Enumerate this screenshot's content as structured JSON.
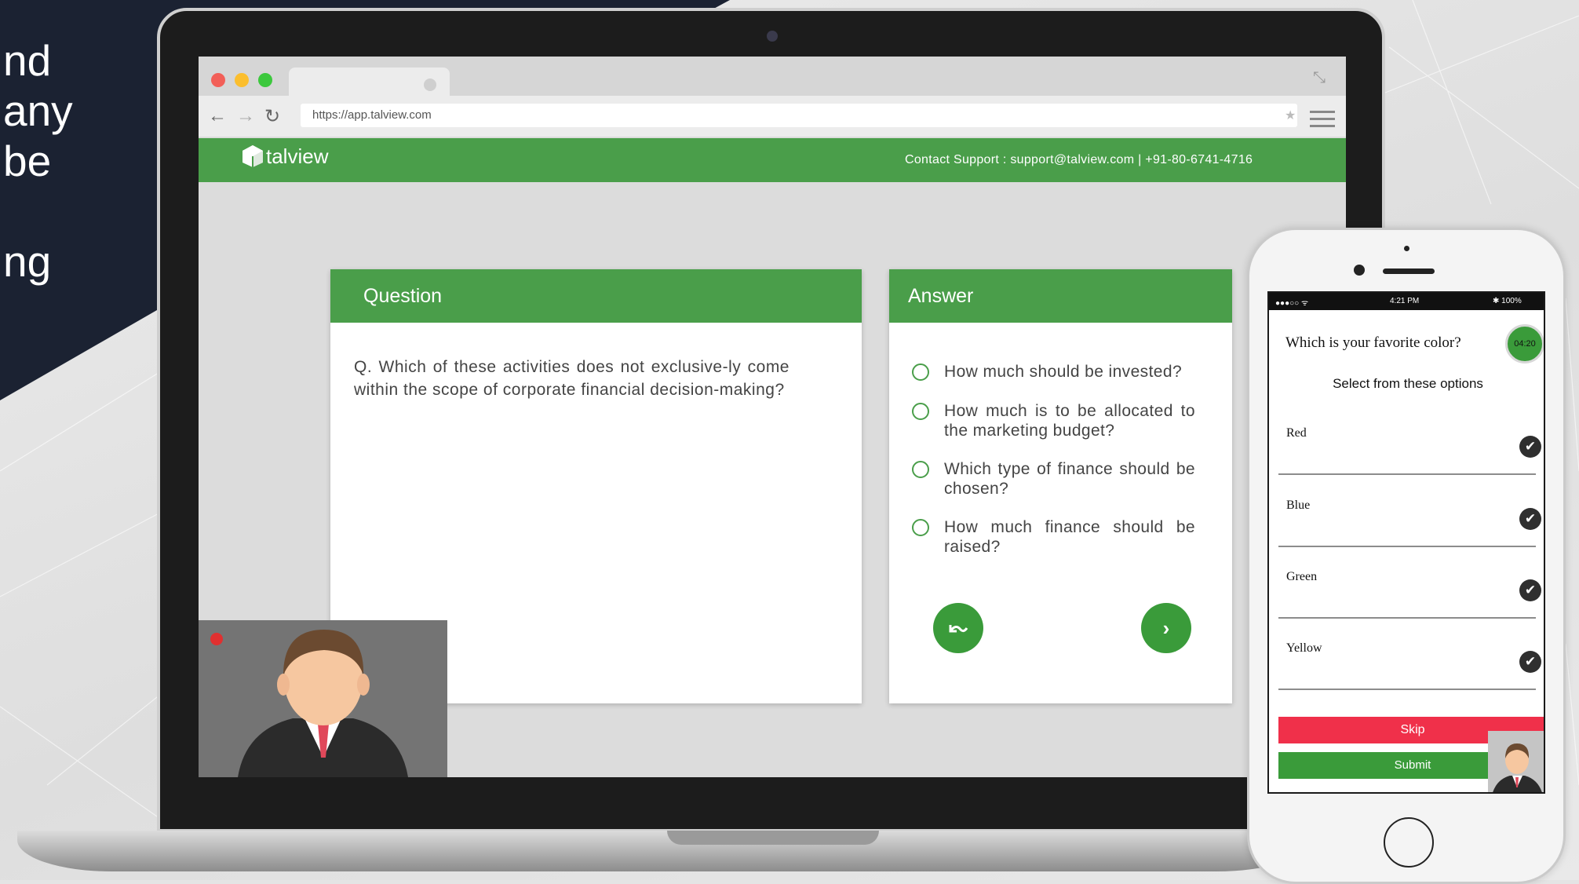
{
  "hero": {
    "lines": [
      "nd",
      "any",
      "be",
      "",
      "ng"
    ]
  },
  "browser": {
    "url": "https://app.talview.com",
    "traffic_lights": [
      "#f25f58",
      "#fbbe2e",
      "#3cc83d"
    ]
  },
  "app": {
    "brand": "talview",
    "contact": "Contact Support : support@talview.com  |  +91-80-6741-4716",
    "accent": "#4a9e4a"
  },
  "question_card": {
    "title": "Question",
    "text": "Q. Which of these activities does not exclusive-ly come within the scope of corporate financial decision-making?"
  },
  "answer_card": {
    "title": "Answer",
    "options": [
      "How much should be invested?",
      "How much is to be allocated to the marketing budget?",
      "Which type of finance should be chosen?",
      "How much finance should be raised?"
    ],
    "prev_icon": "undo-icon",
    "next_icon": "chevron-right-icon"
  },
  "phone": {
    "status": {
      "signal": "●●●○○ ᯤ",
      "time": "4:21 PM",
      "battery": "✱ 100%"
    },
    "question": "Which is your favorite color?",
    "timer": "04:20",
    "subtitle": "Select from these options",
    "options": [
      "Red",
      "Blue",
      "Green",
      "Yellow"
    ],
    "skip": "Skip",
    "submit": "Submit",
    "skip_color": "#f0304a",
    "submit_color": "#3a9b3a"
  }
}
